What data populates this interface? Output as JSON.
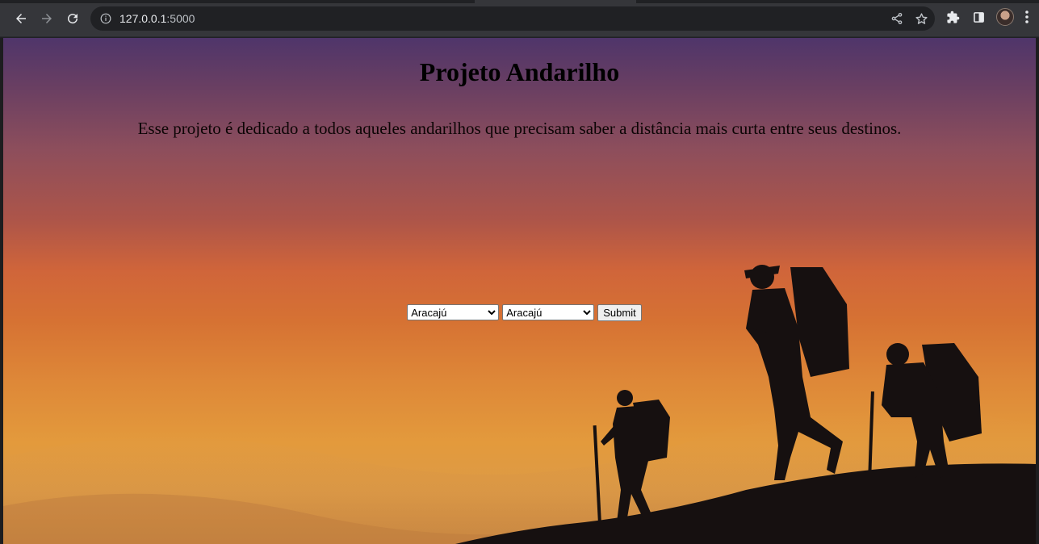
{
  "browser": {
    "url_host": "127.0.0.1",
    "url_port": ":5000"
  },
  "page": {
    "title": "Projeto Andarilho",
    "description": "Esse projeto é dedicado a todos aqueles andarilhos que precisam saber a distância mais curta entre seus destinos.",
    "form": {
      "origin_selected": "Aracajú",
      "destination_selected": "Aracajú",
      "submit_label": "Submit"
    }
  },
  "colors": {
    "chrome_bg": "#35363a",
    "omnibox_bg": "#202124",
    "sky_top": "#4f356a",
    "sky_mid": "#d0653a",
    "sky_bottom": "#e39a3c",
    "silhouette": "#161010"
  }
}
